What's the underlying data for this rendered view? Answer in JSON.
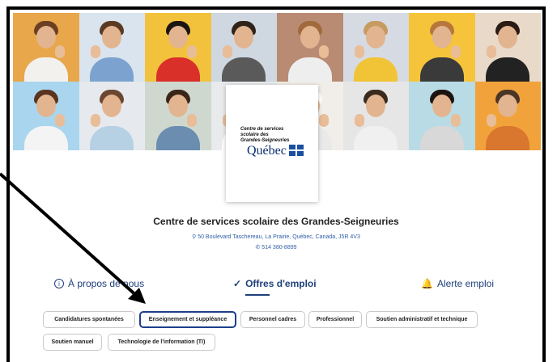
{
  "banner": {
    "tiles": [
      {
        "bg": "#e8a74a",
        "shirt": "#f3f1ee",
        "hair": "#6b3f22"
      },
      {
        "bg": "#d9e4ee",
        "shirt": "#7ca3cf",
        "hair": "#5a3a22"
      },
      {
        "bg": "#f2c23d",
        "shirt": "#d9302a",
        "hair": "#1c1410"
      },
      {
        "bg": "#cfd7e0",
        "shirt": "#5a5a5a",
        "hair": "#2f2219"
      },
      {
        "bg": "#b98b73",
        "shirt": "#eeeeee",
        "hair": "#a06a3c"
      },
      {
        "bg": "#d6dbe3",
        "shirt": "#f1c437",
        "hair": "#c79a61"
      },
      {
        "bg": "#f5c43a",
        "shirt": "#3a3a3a",
        "hair": "#b7773c"
      },
      {
        "bg": "#e9d9c9",
        "shirt": "#222222",
        "hair": "#2a1b14"
      },
      {
        "bg": "#a9d6ee",
        "shirt": "#f4f4f4",
        "hair": "#5a3320"
      },
      {
        "bg": "#e6e9ee",
        "shirt": "#b7d1e4",
        "hair": "#6b4630"
      },
      {
        "bg": "#cfd8cf",
        "shirt": "#6b8db0",
        "hair": "#3a2618"
      },
      {
        "bg": "#e8eaec",
        "shirt": "#ffffff",
        "hair": "#ffffff"
      },
      {
        "bg": "#f1eee9",
        "shirt": "#e9e9e9",
        "hair": "#ffffff"
      },
      {
        "bg": "#e6e6e6",
        "shirt": "#f0f0f0",
        "hair": "#3a2a1e"
      },
      {
        "bg": "#b9dbe5",
        "shirt": "#d8d8d8",
        "hair": "#1c1410"
      },
      {
        "bg": "#f2a23a",
        "shirt": "#d9772e",
        "hair": "#4a3526"
      }
    ]
  },
  "logo": {
    "small_text": "Centre de services\nscolaire des\nGrandes-Seigneuries",
    "wordmark": "Québec"
  },
  "org": {
    "name": "Centre de services scolaire des Grandes-Seigneuries",
    "address": "50 Boulevard Taschereau, La Prairie, Québec, Canada, J5R 4V3",
    "phone": "514 380-8899"
  },
  "tabs": {
    "about": "À propos de nous",
    "jobs": "Offres d'emploi",
    "alert": "Alerte emploi"
  },
  "chips": [
    "Candidatures spontanées",
    "Enseignement et suppléance",
    "Personnel cadres",
    "Professionnel",
    "Soutien administratif et technique",
    "Soutien manuel",
    "Technologie de l'information (TI)"
  ],
  "colors": {
    "accent": "#1f3f7a",
    "link": "#3060a8"
  }
}
